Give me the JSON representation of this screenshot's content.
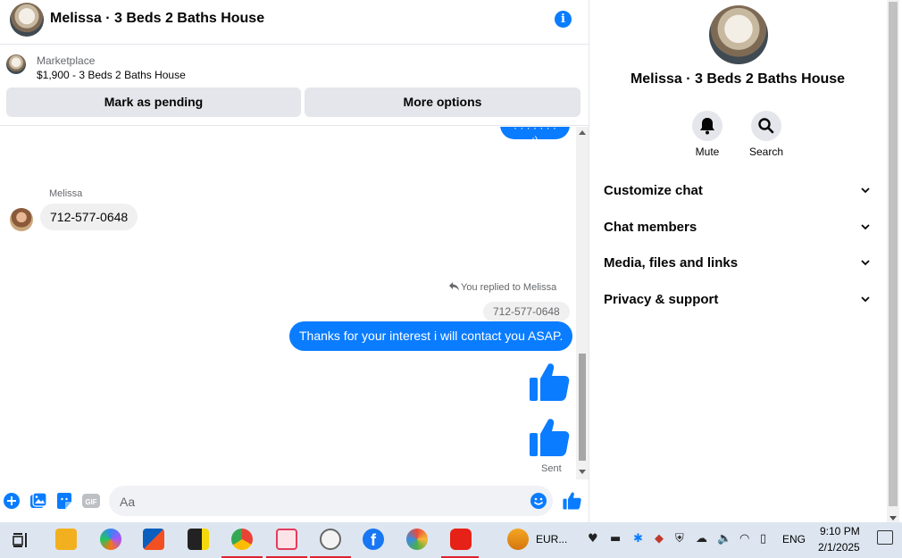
{
  "header": {
    "title": "Melissa · 3 Beds 2 Baths House"
  },
  "marketplace": {
    "label": "Marketplace",
    "item": "$1,900 - 3 Beds 2 Baths House",
    "mark_pending": "Mark as pending",
    "more_options": "More options"
  },
  "messages": {
    "partial_top": "· · · · · · · :)",
    "sender": "Melissa",
    "incoming_text": "712-577-0648",
    "replied_note": "You replied to Melissa",
    "quoted_text": "712-577-0648",
    "outgoing_text": "Thanks for your interest i will contact you ASAP.",
    "status": "Sent"
  },
  "composer": {
    "placeholder": "Aa"
  },
  "side": {
    "title": "Melissa · 3 Beds 2 Baths House",
    "mute_label": "Mute",
    "search_label": "Search",
    "sections": [
      "Customize chat",
      "Chat members",
      "Media, files and links",
      "Privacy & support"
    ]
  },
  "taskbar": {
    "app_label": "EUR...",
    "lang": "ENG",
    "time": "9:10 PM",
    "date": "2/1/2025"
  },
  "colors": {
    "accent": "#0a7cff",
    "bubble_grey": "#f0f0f0",
    "taskbar": "#dde6f0"
  }
}
